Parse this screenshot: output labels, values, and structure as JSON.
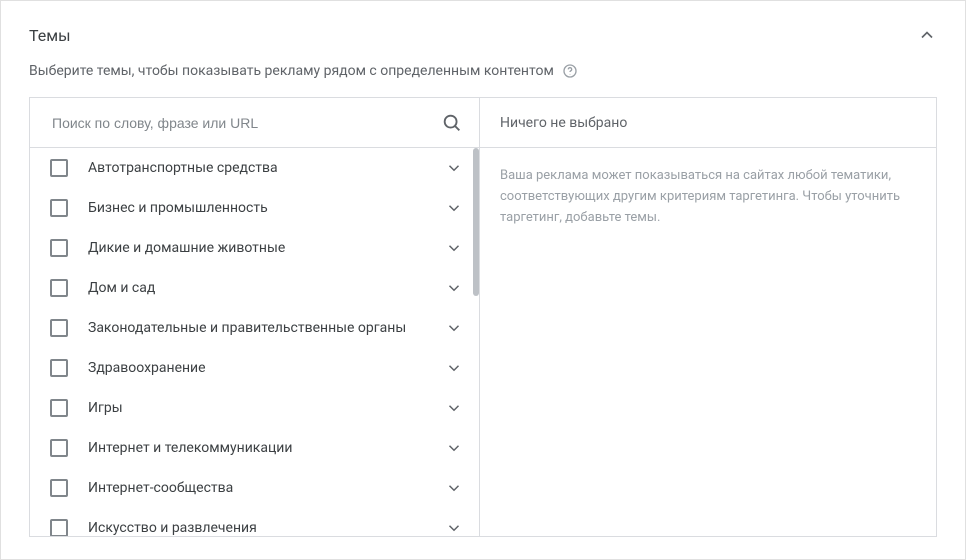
{
  "header": {
    "title": "Темы"
  },
  "subtitle": "Выберите темы, чтобы показывать рекламу рядом с определенным контентом",
  "search": {
    "placeholder": "Поиск по слову, фразе или URL"
  },
  "topics": [
    {
      "label": "Автотранспортные средства"
    },
    {
      "label": "Бизнес и промышленность"
    },
    {
      "label": "Дикие и домашние животные"
    },
    {
      "label": "Дом и сад"
    },
    {
      "label": "Законодательные и правительственные органы"
    },
    {
      "label": "Здравоохранение"
    },
    {
      "label": "Игры"
    },
    {
      "label": "Интернет и телекоммуникации"
    },
    {
      "label": "Интернет-сообщества"
    },
    {
      "label": "Искусство и развлечения"
    }
  ],
  "right": {
    "header": "Ничего не выбрано",
    "body": "Ваша реклама может показываться на сайтах любой тематики, соответствующих другим критериям таргетинга. Чтобы уточнить таргетинг, добавьте темы."
  }
}
